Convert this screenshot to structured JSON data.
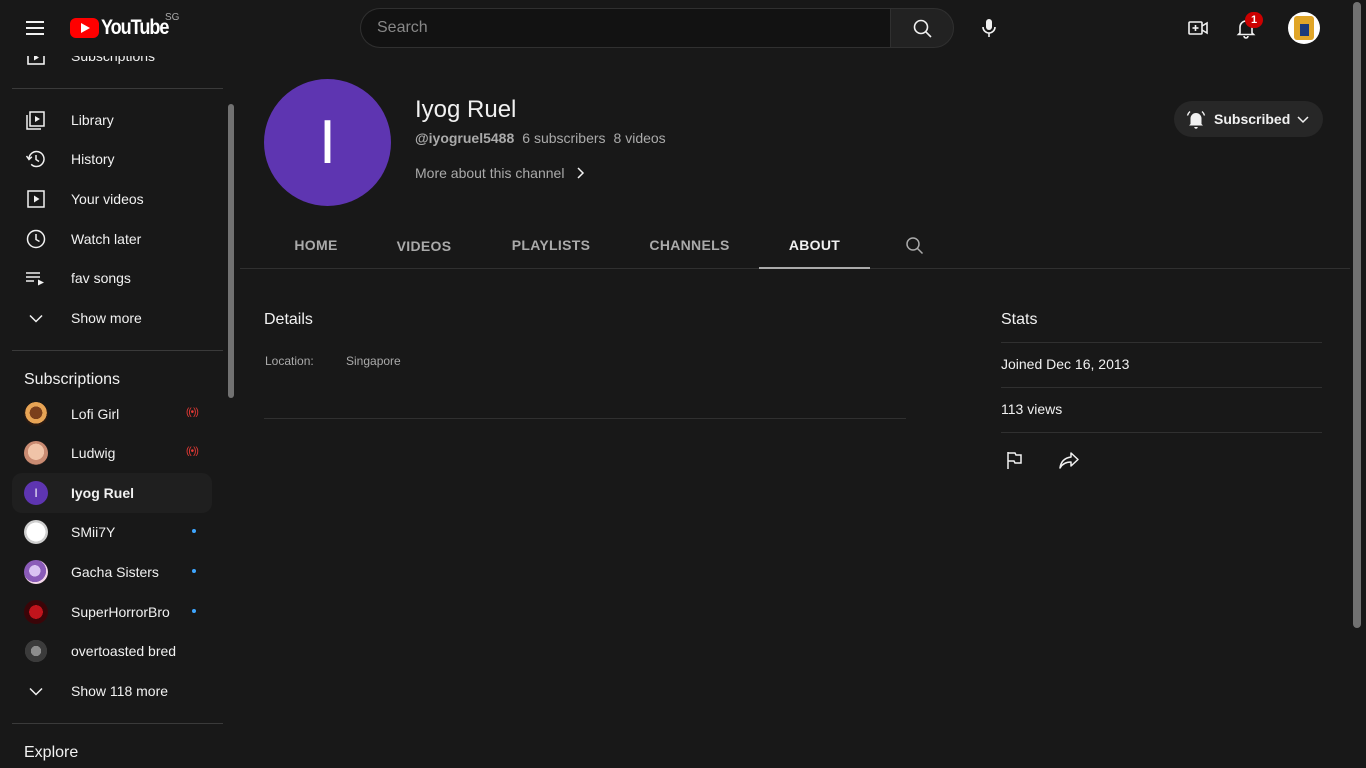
{
  "masthead": {
    "logo_text": "YouTube",
    "country_code": "SG",
    "search_placeholder": "Search",
    "notification_count": "1"
  },
  "sidebar": {
    "top_partial_label": "Subscriptions",
    "you_items": [
      {
        "label": "Library",
        "icon": "library-icon"
      },
      {
        "label": "History",
        "icon": "history-icon"
      },
      {
        "label": "Your videos",
        "icon": "your-videos-icon"
      },
      {
        "label": "Watch later",
        "icon": "watch-later-icon"
      },
      {
        "label": "fav songs",
        "icon": "playlist-icon"
      },
      {
        "label": "Show more",
        "icon": "chevron-down-icon"
      }
    ],
    "subscriptions_heading": "Subscriptions",
    "subscriptions": [
      {
        "label": "Lofi Girl",
        "status": "live",
        "live_glyph": "((•))"
      },
      {
        "label": "Ludwig",
        "status": "live",
        "live_glyph": "((•))"
      },
      {
        "label": "Iyog Ruel",
        "status": "active",
        "avatar_letter": "I"
      },
      {
        "label": "SMii7Y",
        "status": "new"
      },
      {
        "label": "Gacha Sisters",
        "status": "new"
      },
      {
        "label": "SuperHorrorBro",
        "status": "new"
      },
      {
        "label": "overtoasted bred",
        "status": "none"
      }
    ],
    "show_more_subs": "Show 118 more",
    "explore_heading": "Explore"
  },
  "channel": {
    "avatar_letter": "I",
    "avatar_color": "#5e35b1",
    "name": "Iyog Ruel",
    "handle": "@iyogruel5488",
    "subscribers": "6 subscribers",
    "videos": "8 videos",
    "more_about": "More about this channel",
    "subscribed_label": "Subscribed"
  },
  "tabs": [
    {
      "label": "HOME"
    },
    {
      "label": "VIDEOS"
    },
    {
      "label": "PLAYLISTS"
    },
    {
      "label": "CHANNELS"
    },
    {
      "label": "ABOUT",
      "active": true
    }
  ],
  "about": {
    "details_title": "Details",
    "location_label": "Location:",
    "location_value": "Singapore",
    "stats_title": "Stats",
    "joined": "Joined Dec 16, 2013",
    "views": "113 views"
  }
}
